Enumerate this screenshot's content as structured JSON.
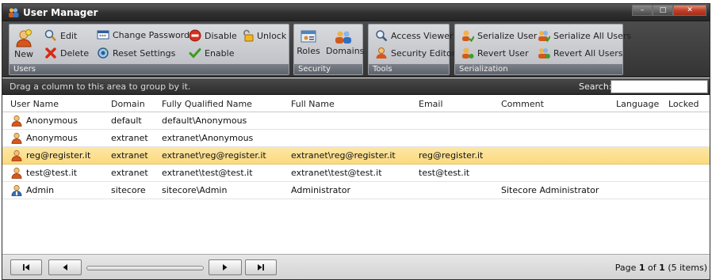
{
  "window": {
    "title": "User Manager",
    "controls": {
      "minimize": "–",
      "maximize": "□",
      "close": "✕"
    }
  },
  "ribbon": {
    "users": {
      "label": "Users",
      "new": "New",
      "edit": "Edit",
      "delete": "Delete",
      "change_password": "Change Password",
      "reset_settings": "Reset Settings",
      "disable": "Disable",
      "enable": "Enable",
      "unlock": "Unlock"
    },
    "security": {
      "label": "Security",
      "roles": "Roles",
      "domains": "Domains"
    },
    "tools": {
      "label": "Tools",
      "access_viewer": "Access Viewer",
      "security_editor": "Security Editor"
    },
    "serialization": {
      "label": "Serialization",
      "serialize_user": "Serialize User",
      "serialize_all_users": "Serialize All Users",
      "revert_user": "Revert User",
      "revert_all_users": "Revert All Users"
    }
  },
  "groupbar": {
    "hint": "Drag a column to this area to group by it.",
    "search_label": "Search:",
    "search_value": ""
  },
  "grid": {
    "columns": [
      "User Name",
      "Domain",
      "Fully Qualified Name",
      "Full Name",
      "Email",
      "Comment",
      "Language",
      "Locked"
    ],
    "rows": [
      {
        "user": "Anonymous",
        "domain": "default",
        "fqn": "default\\Anonymous",
        "full_name": "",
        "email": "",
        "comment": "",
        "icon": "user-icon"
      },
      {
        "user": "Anonymous",
        "domain": "extranet",
        "fqn": "extranet\\Anonymous",
        "full_name": "",
        "email": "",
        "comment": "",
        "icon": "user-icon"
      },
      {
        "user": "reg@register.it",
        "domain": "extranet",
        "fqn": "extranet\\reg@register.it",
        "full_name": "extranet\\reg@register.it",
        "email": "reg@register.it",
        "comment": "",
        "icon": "user-icon",
        "selected": true
      },
      {
        "user": "test@test.it",
        "domain": "extranet",
        "fqn": "extranet\\test@test.it",
        "full_name": "extranet\\test@test.it",
        "email": "test@test.it",
        "comment": "",
        "icon": "user-icon"
      },
      {
        "user": "Admin",
        "domain": "sitecore",
        "fqn": "sitecore\\Admin",
        "full_name": "Administrator",
        "email": "",
        "comment": "Sitecore Administrator",
        "icon": "admin-icon"
      }
    ]
  },
  "pager": {
    "prefix": "Page ",
    "current": "1",
    "of": " of ",
    "total": "1",
    "suffix": " (5 items)"
  },
  "colors": {
    "selected_row": "#fbd97e",
    "titlebar": "#2f2f2f",
    "ribbon_group": "#c9ccd1"
  }
}
